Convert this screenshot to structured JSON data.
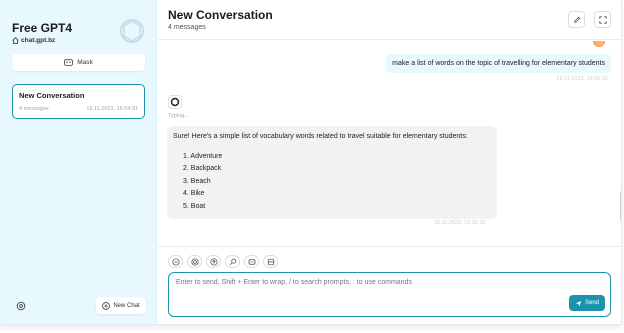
{
  "sidebar": {
    "brand_title": "Free GPT4",
    "brand_subtitle": "chat.gpt.bz",
    "mask_label": "Mask",
    "conversation": {
      "title": "New Conversation",
      "count": "4 messages",
      "date": "16.11.2023, 16:54:31"
    },
    "new_chat_label": "New Chat"
  },
  "header": {
    "title": "New Conversation",
    "subtitle": "4 messages"
  },
  "messages": {
    "user_text": "make a list of words on the topic of travelling for elementary students",
    "user_date": "16.11.2023, 16:55:26",
    "typing_label": "Typing...",
    "bot_intro": "Sure! Here's a simple list of vocabulary words related to travel suitable for elementary students:",
    "bot_list": [
      "1. Adventure",
      "2. Backpack",
      "3. Beach",
      "4. Bike",
      "5. Boat"
    ],
    "bot_date": "16.11.2023, 16:55:26"
  },
  "input": {
    "placeholder": "Enter to send, Shift + Enter to wrap, / to search prompts, : to use commands",
    "send_label": "Send"
  },
  "colors": {
    "accent": "#1d93ab",
    "sidebar_bg": "#e7f8ff",
    "bot_bubble_bg": "#f2f2f2"
  },
  "icons": [
    "openai-logo-icon",
    "home-icon",
    "mask-icon",
    "settings-icon",
    "plus-icon",
    "edit-icon",
    "fullscreen-icon",
    "minus-icon",
    "theme-icon",
    "arrow-up-icon",
    "search-icon",
    "robot-icon",
    "layout-icon",
    "send-icon"
  ]
}
